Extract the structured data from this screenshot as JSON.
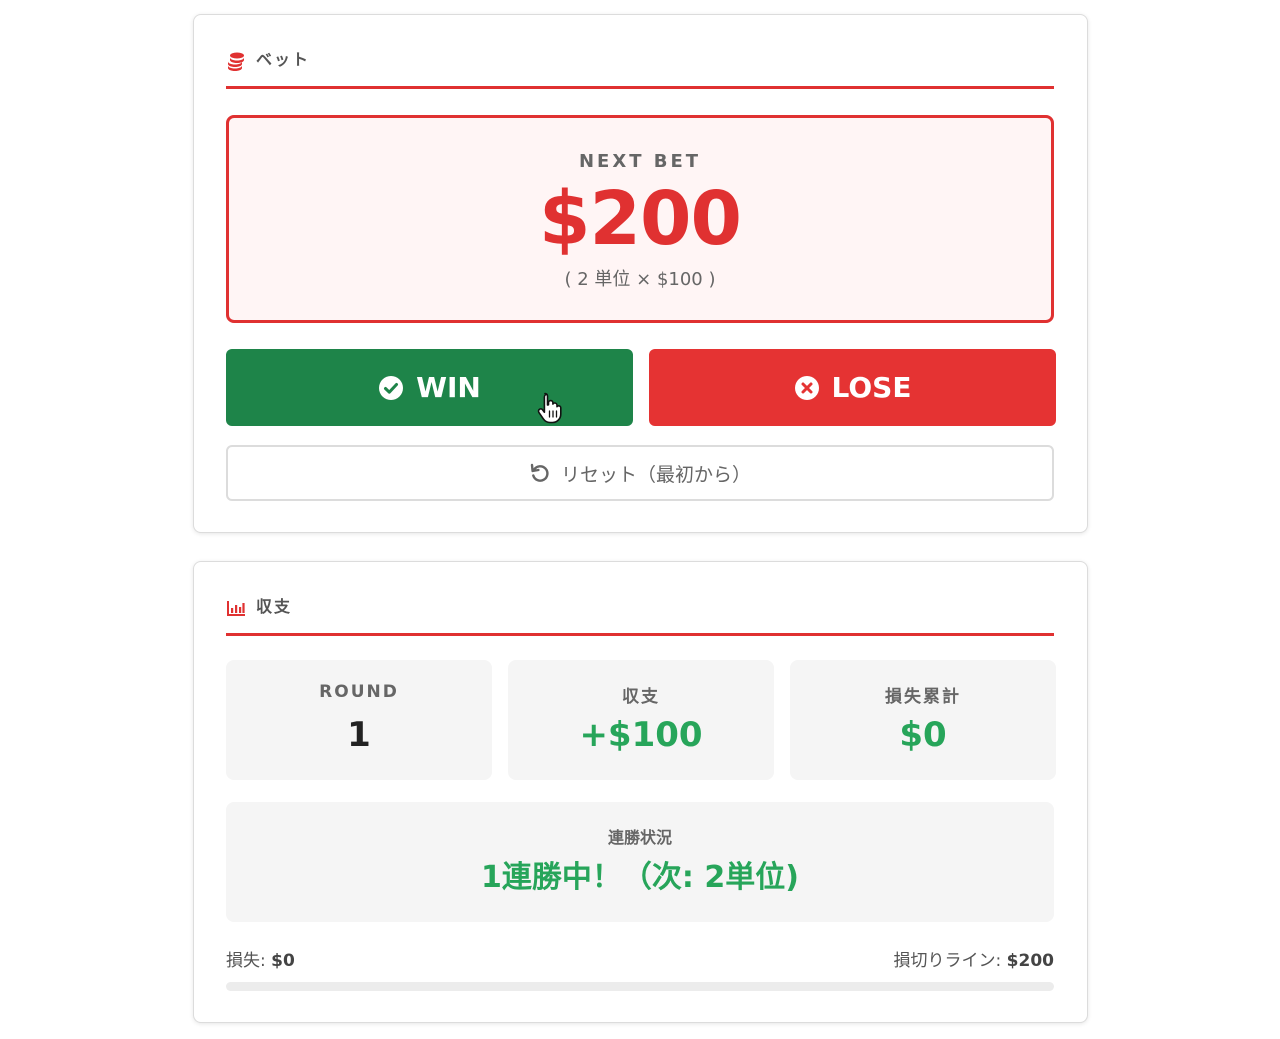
{
  "bet_card": {
    "title": "ベット",
    "next_bet": {
      "label": "NEXT BET",
      "amount": "$200",
      "detail": "( 2 単位 × $100 )"
    },
    "win_label": "WIN",
    "lose_label": "LOSE",
    "reset_label": "リセット（最初から）"
  },
  "stats_card": {
    "title": "収支",
    "round": {
      "label": "ROUND",
      "value": "1"
    },
    "profit": {
      "label": "収支",
      "value": "+$100"
    },
    "loss_total": {
      "label": "損失累計",
      "value": "$0"
    },
    "streak": {
      "label": "連勝状況",
      "value": "1連勝中！（次: 2単位)"
    },
    "progress": {
      "loss_label": "損失:",
      "loss_value": "$0",
      "stop_loss_label": "損切りライン:",
      "stop_loss_value": "$200",
      "fraction": 0
    }
  },
  "colors": {
    "accent_red": "#e03131",
    "win_green": "#1e8449",
    "lose_red": "#e53333",
    "positive_green": "#27a55a"
  },
  "icons": {
    "bet": "coins-icon",
    "stats": "bar-chart-icon",
    "win": "check-circle-icon",
    "lose": "x-circle-icon",
    "reset": "rotate-left-icon",
    "cursor": "hand-pointer-icon"
  }
}
